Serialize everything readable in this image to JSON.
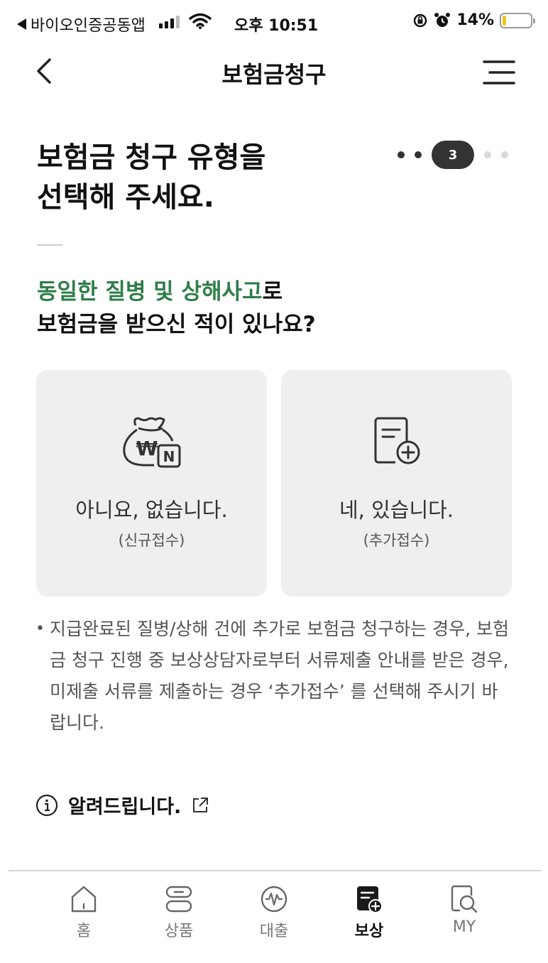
{
  "status_bar": {
    "back_app": "바이오인증공동앱",
    "time": "오후 10:51",
    "battery_pct": "14%",
    "battery_level": 0.14
  },
  "header": {
    "title": "보험금청구"
  },
  "heading": {
    "line1": "보험금 청구 유형을",
    "line2": "선택해 주세요."
  },
  "step": {
    "current": "3"
  },
  "question": {
    "highlight": "동일한 질병 및 상해사고",
    "tail": "로",
    "line2": "보험금을 받으신 적이 있나요?"
  },
  "options": [
    {
      "label": "아니요, 없습니다.",
      "sub": "(신규접수)",
      "icon": "money-bag-won-new-icon"
    },
    {
      "label": "네, 있습니다.",
      "sub": "(추가접수)",
      "icon": "document-add-icon"
    }
  ],
  "notice": {
    "bullet": "•",
    "text": "지급완료된 질병/상해 건에 추가로 보험금 청구하는 경우, 보험금 청구 진행 중 보상상담자로부터 서류제출 안내를 받은 경우, 미제출 서류를 제출하는 경우 ‘추가접수’ 를 선택해 주시기 바랍니다."
  },
  "info_link": {
    "label": "알려드립니다."
  },
  "tabs": [
    {
      "label": "홈",
      "icon": "home-icon"
    },
    {
      "label": "상품",
      "icon": "product-icon"
    },
    {
      "label": "대출",
      "icon": "loan-icon"
    },
    {
      "label": "보상",
      "icon": "claim-icon",
      "active": true
    },
    {
      "label": "MY",
      "icon": "my-search-icon"
    }
  ],
  "colors": {
    "accent_green": "#2e7d48",
    "card_bg": "#efefef",
    "battery_fill": "#f0c419"
  }
}
